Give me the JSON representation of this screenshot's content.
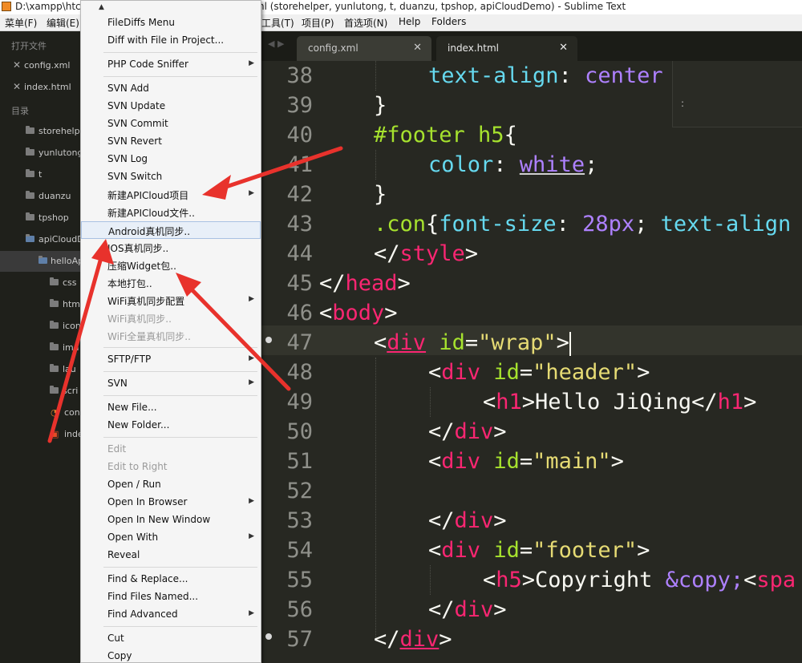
{
  "window": {
    "title_left": "D:\\xampp\\htc",
    "title_right": "nl (storehelper, yunlutong, t, duanzu, tpshop, apiCloudDemo) - Sublime Text"
  },
  "menubar": {
    "items": [
      "菜单(F)",
      "编辑(E)",
      "工具(T)",
      "项目(P)",
      "首选项(N)",
      "Help",
      "Folders"
    ]
  },
  "sidebar": {
    "open_files_heading": "打开文件",
    "open_files": [
      "config.xml",
      "index.html"
    ],
    "folders_heading": "目录",
    "folders": [
      "storehelp",
      "yunlutong",
      "t",
      "duanzu",
      "tpshop",
      "apiCloudD",
      "helloAp",
      "css",
      "htm",
      "icon",
      "ima",
      "lau",
      "scri",
      "con",
      "inde"
    ],
    "close_glyph": "✕"
  },
  "tabs": [
    {
      "label": "config.xml",
      "close": "✕"
    },
    {
      "label": "index.html",
      "close": "✕"
    }
  ],
  "tab_nav_glyphs": "◀ ▶",
  "find_panel": {
    "text": ":"
  },
  "editor": {
    "line_numbers": [
      "38",
      "39",
      "40",
      "41",
      "42",
      "43",
      "44",
      "45",
      "46",
      "47",
      "48",
      "49",
      "50",
      "51",
      "52",
      "53",
      "54",
      "55",
      "56",
      "57"
    ],
    "code": {
      "l38_prop": "text-align",
      "l38_colon": ": ",
      "l38_val": "center",
      "l39": "}",
      "l40_sel": "#footer h5",
      "l40_brace": "{",
      "l41_prop": "color",
      "l41_colon": ": ",
      "l41_val": "white",
      "l41_semi": ";",
      "l42": "}",
      "l43_sel": ".con",
      "l43_brace": "{",
      "l43_prop1": "font-size",
      "l43_colon1": ": ",
      "l43_val1": "28px",
      "l43_semi1": "; ",
      "l43_prop2": "text-align",
      "l44_open": "</",
      "l44_tag": "style",
      "l44_close": ">",
      "l45_open": "</",
      "l45_tag": "head",
      "l45_close": ">",
      "l46_open": "<",
      "l46_tag": "body",
      "l46_close": ">",
      "l47_open": "<",
      "l47_tag": "div",
      "l47_attr": "id",
      "l47_eq": "=",
      "l47_str": "\"wrap\"",
      "l47_close": ">",
      "l48_open": "<",
      "l48_tag": "div",
      "l48_attr": "id",
      "l48_eq": "=",
      "l48_str": "\"header\"",
      "l48_close": ">",
      "l49_open": "<",
      "l49_tag": "h1",
      "l49_mid": ">Hello JiQing</",
      "l49_tag2": "h1",
      "l49_close": ">",
      "l50_open": "</",
      "l50_tag": "div",
      "l50_close": ">",
      "l51_open": "<",
      "l51_tag": "div",
      "l51_attr": "id",
      "l51_eq": "=",
      "l51_str": "\"main\"",
      "l51_close": ">",
      "l53_open": "</",
      "l53_tag": "div",
      "l53_close": ">",
      "l54_open": "<",
      "l54_tag": "div",
      "l54_attr": "id",
      "l54_eq": "=",
      "l54_str": "\"footer\"",
      "l54_close": ">",
      "l55_open": "<",
      "l55_tag": "h5",
      "l55_mid": ">Copyright ",
      "l55_ent": "&copy;",
      "l55_lt": "<",
      "l55_tag2": "spa",
      "l56_open": "</",
      "l56_tag": "div",
      "l56_close": ">",
      "l57_open": "</",
      "l57_tag": "div",
      "l57_close": ">"
    }
  },
  "context_menu": {
    "top_arrow": "▲",
    "submenu_arrow": "▶",
    "items": [
      {
        "label": "FileDiffs Menu"
      },
      {
        "label": "Diff with File in Project..."
      },
      {
        "label": "PHP Code Sniffer"
      },
      {
        "label": "SVN Add"
      },
      {
        "label": "SVN Update"
      },
      {
        "label": "SVN Commit"
      },
      {
        "label": "SVN Revert"
      },
      {
        "label": "SVN Log"
      },
      {
        "label": "SVN Switch"
      },
      {
        "label": "新建APICloud项目"
      },
      {
        "label": "新建APICloud文件.."
      },
      {
        "label": "Android真机同步.."
      },
      {
        "label": "IOS真机同步.."
      },
      {
        "label": "压缩Widget包.."
      },
      {
        "label": "本地打包.."
      },
      {
        "label": "WiFi真机同步配置"
      },
      {
        "label": "WiFi真机同步.."
      },
      {
        "label": "WiFi全量真机同步.."
      },
      {
        "label": "SFTP/FTP"
      },
      {
        "label": "SVN"
      },
      {
        "label": "New File..."
      },
      {
        "label": "New Folder..."
      },
      {
        "label": "Edit"
      },
      {
        "label": "Edit to Right"
      },
      {
        "label": "Open / Run"
      },
      {
        "label": "Open In Browser"
      },
      {
        "label": "Open In New Window"
      },
      {
        "label": "Open With"
      },
      {
        "label": "Reveal"
      },
      {
        "label": "Find & Replace..."
      },
      {
        "label": "Find Files Named..."
      },
      {
        "label": "Find Advanced"
      },
      {
        "label": "Cut"
      },
      {
        "label": "Copy"
      }
    ]
  },
  "colors": {
    "annotation_arrow": "#e8322c",
    "editor_bg": "#272822",
    "tag": "#f92672",
    "attr": "#a6e22e",
    "string": "#e6db74",
    "keyword_prop": "#66d9ef",
    "value": "#ae81ff"
  }
}
